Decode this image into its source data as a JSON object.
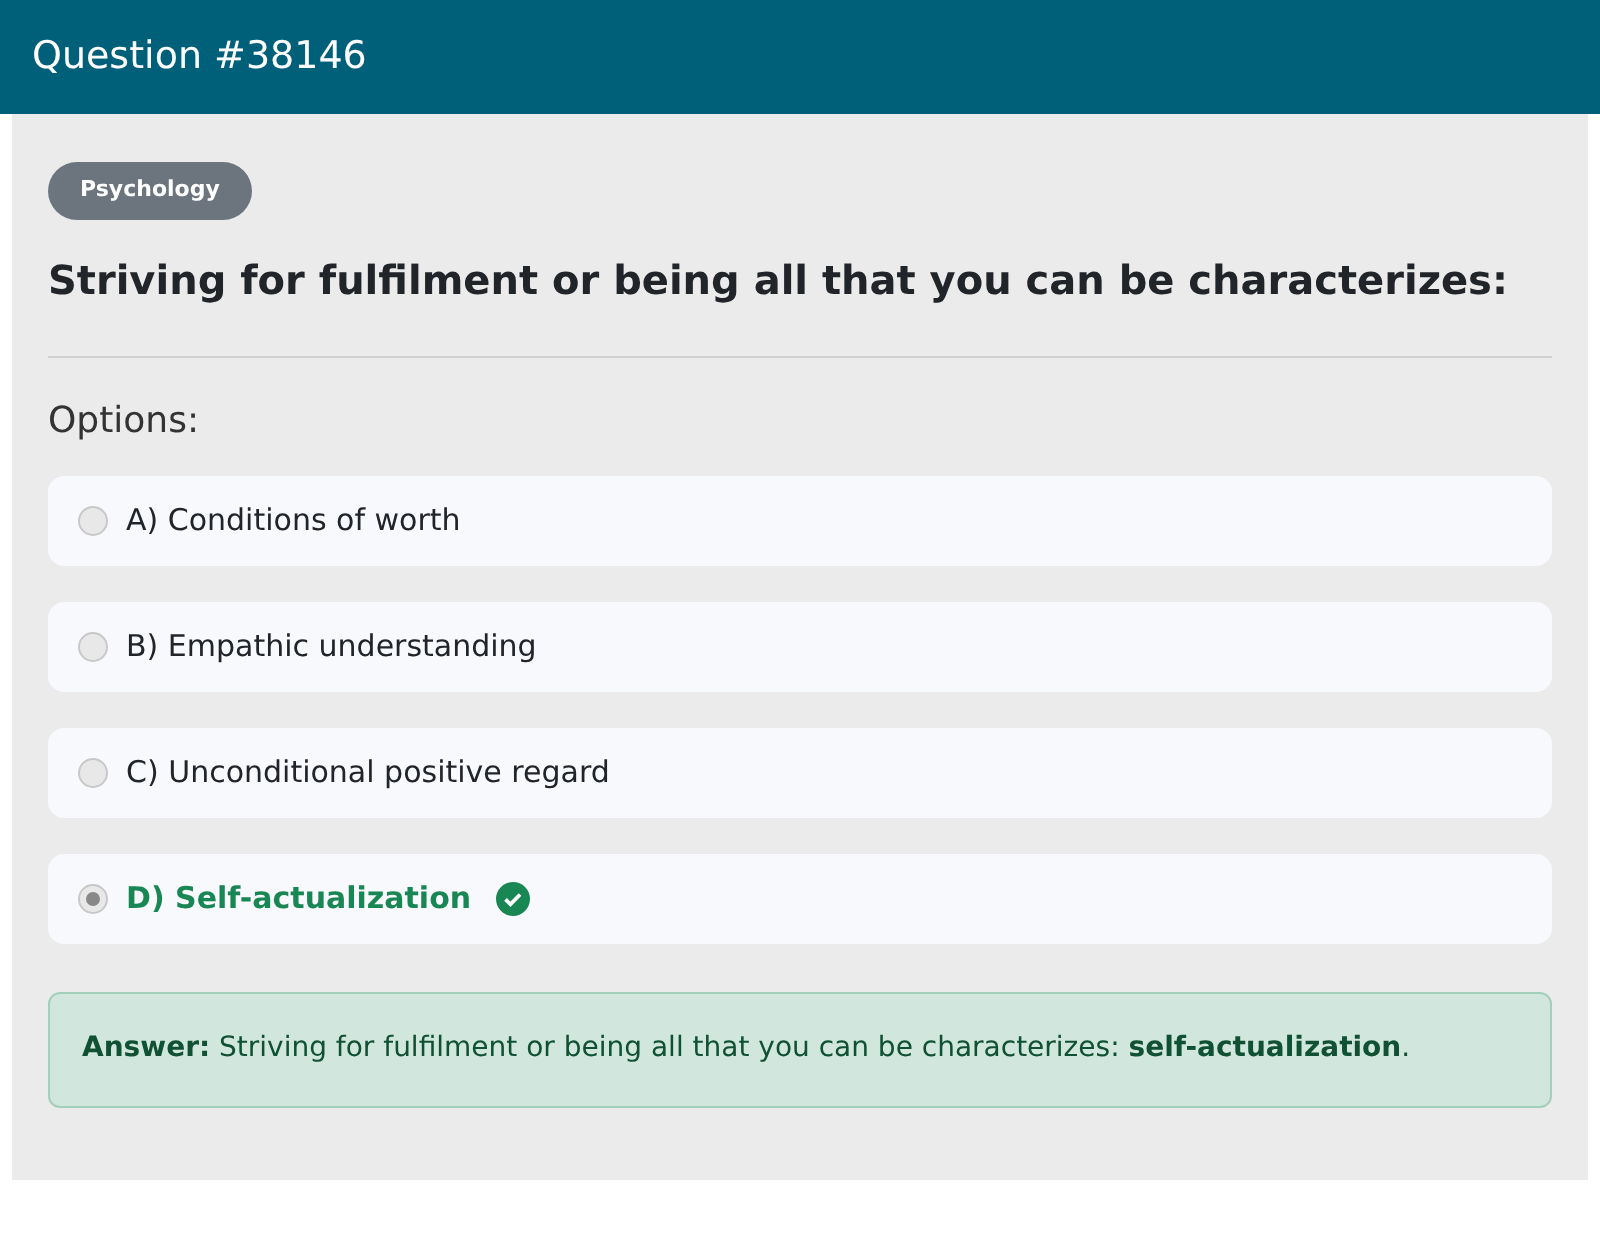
{
  "header": {
    "title": "Question #38146"
  },
  "category": "Psychology",
  "question": "Striving for fulfilment or being all that you can be characterizes:",
  "options_label": "Options:",
  "options": [
    {
      "label": "A) Conditions of worth",
      "selected": false,
      "correct": false
    },
    {
      "label": "B) Empathic understanding",
      "selected": false,
      "correct": false
    },
    {
      "label": "C) Unconditional positive regard",
      "selected": false,
      "correct": false
    },
    {
      "label": "D) Self-actualization",
      "selected": true,
      "correct": true
    }
  ],
  "answer": "**Answer:** Striving for fulfilment or being all that you can be characterizes: **self-actualization**."
}
